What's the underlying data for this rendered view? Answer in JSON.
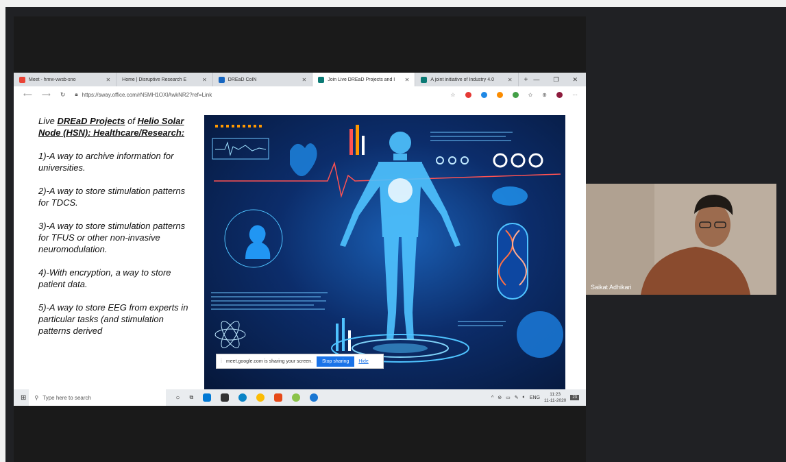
{
  "browser": {
    "tabs": [
      {
        "label": "Meet - hmw-vwsb-sno",
        "color": "#ea4335"
      },
      {
        "label": "Home | Disruptive Research E",
        "color": "#cccccc"
      },
      {
        "label": "DREaD CoIN",
        "color": "#1565c0"
      },
      {
        "label": "Join Live DREaD Projects and I",
        "color": "#0b7a75"
      },
      {
        "label": "A joint initiative of Industry 4.0",
        "color": "#0b7a75"
      }
    ],
    "new_tab": "+",
    "url": "https://sway.office.com/rN5MH1OXlAwkNR2?ref=Link"
  },
  "slide": {
    "title_prefix": "Live ",
    "title_link1": "DREaD Projects",
    "title_mid": " of ",
    "title_link2": "Helio Solar Node (HSN): Healthcare/Research:",
    "items": [
      "1)-A way to archive information for universities.",
      "2)-A way to store stimulation patterns for TDCS.",
      "3)-A way to store stimulation patterns for TFUS or other non-invasive neuromodulation.",
      "4)-With encryption, a way to store patient data.",
      "5)-A way to store EEG from experts in particular tasks (and stimulation patterns derived"
    ]
  },
  "share_bar": {
    "message": "meet.google.com is sharing your screen.",
    "stop_label": "Stop sharing",
    "hide_label": "Hide"
  },
  "taskbar": {
    "search_placeholder": "Type here to search",
    "lang": "ENG",
    "time": "11:23",
    "date": "11-11-2020",
    "notification_count": "23"
  },
  "participant": {
    "name": "Saikat Adhikari"
  }
}
